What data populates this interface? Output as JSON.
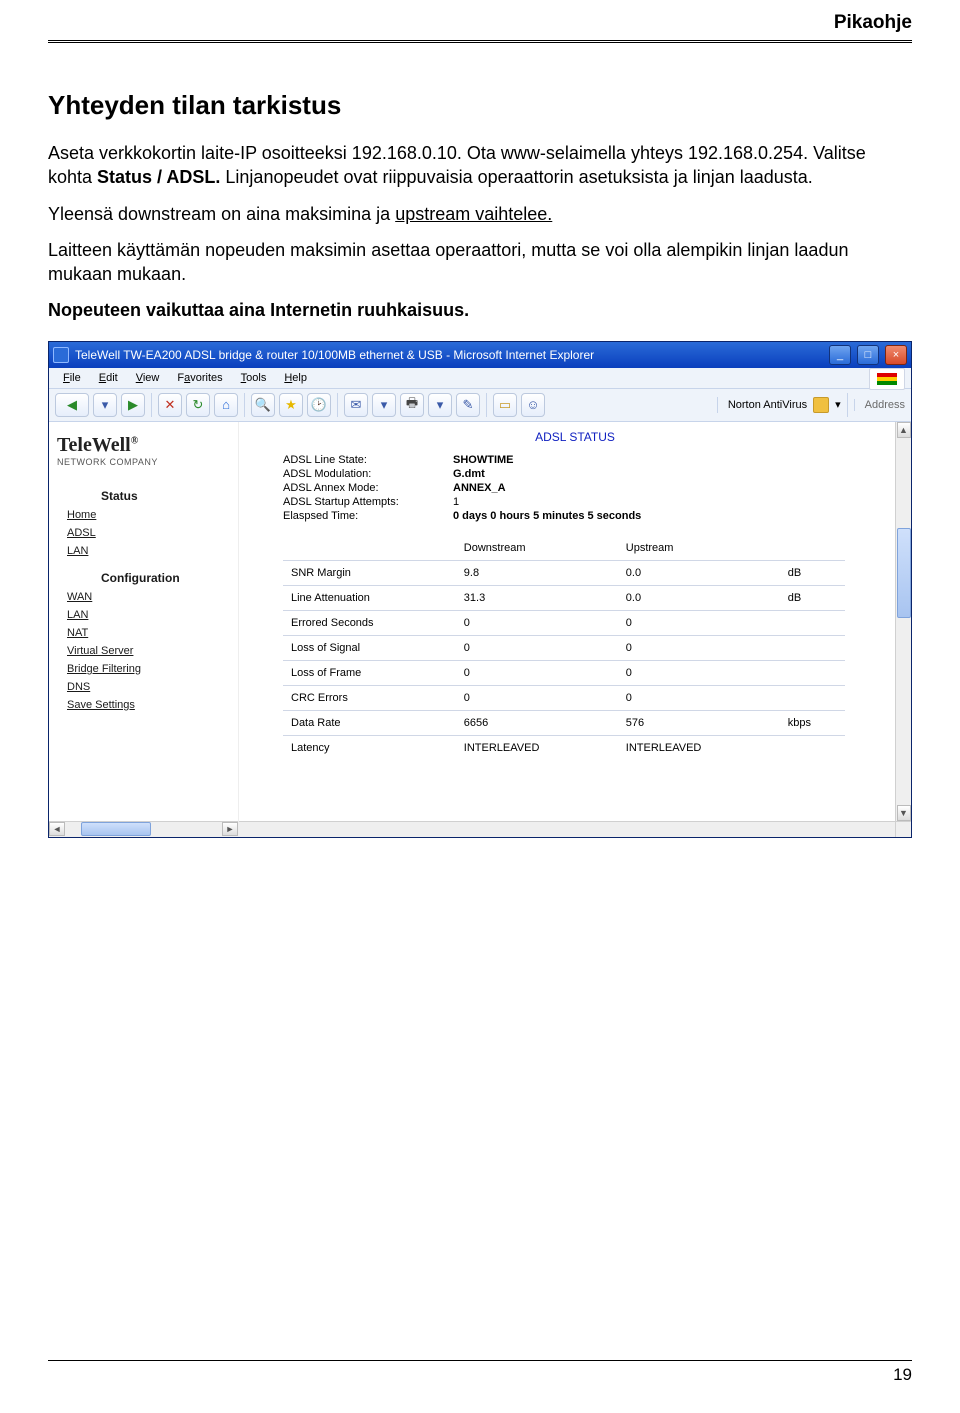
{
  "page": {
    "header_label": "Pikaohje",
    "number": "19"
  },
  "doc": {
    "h1": "Yhteyden tilan tarkistus",
    "p1a": "Aseta verkkokortin laite-IP osoitteeksi 192.168.0.10. Ota www-selaimella yhteys 192.168.0.254. Valitse kohta ",
    "p1b": "Status / ADSL.",
    "p1c": " Linjanopeudet ovat riippuvaisia operaattorin asetuksista ja linjan laadusta.",
    "p2a": "Yleensä downstream on aina maksimina ja ",
    "p2b": "upstream vaihtelee.",
    "p3": "Laitteen käyttämän nopeuden maksimin asettaa operaattori, mutta se voi olla alempikin linjan laadun mukaan mukaan.",
    "p4": "Nopeuteen vaikuttaa aina Internetin ruuhkaisuus."
  },
  "browser": {
    "title": "TeleWell TW-EA200 ADSL bridge & router 10/100MB ethernet & USB - Microsoft Internet Explorer",
    "menu": {
      "file": "File",
      "edit": "Edit",
      "view": "View",
      "favorites": "Favorites",
      "tools": "Tools",
      "help": "Help"
    },
    "norton": "Norton AntiVirus",
    "address_label": "Address",
    "win_btn": {
      "min": "_",
      "max": "□",
      "close": "×"
    },
    "menu_accel": {
      "file": "F",
      "edit": "E",
      "view": "V",
      "favorites": "a",
      "tools": "T",
      "help": "H"
    }
  },
  "sidebar": {
    "brand": "TeleWell",
    "sub": "NETWORK  COMPANY",
    "sec_status": "Status",
    "sec_config": "Configuration",
    "links_status": [
      "Home",
      "ADSL",
      "LAN"
    ],
    "links_config": [
      "WAN",
      "LAN",
      "NAT",
      "Virtual Server",
      "Bridge Filtering",
      "DNS",
      "Save Settings"
    ]
  },
  "status": {
    "title": "ADSL STATUS",
    "rows": [
      {
        "k": "ADSL Line State:",
        "v": "SHOWTIME",
        "bold": true
      },
      {
        "k": "ADSL Modulation:",
        "v": "G.dmt",
        "bold": true
      },
      {
        "k": "ADSL Annex Mode:",
        "v": "ANNEX_A",
        "bold": true
      },
      {
        "k": "ADSL Startup Attempts:",
        "v": "1",
        "bold": false
      },
      {
        "k": "Elaspsed Time:",
        "v": "0 days 0 hours 5 minutes 5 seconds",
        "bold": true
      }
    ],
    "col_down": "Downstream",
    "col_up": "Upstream",
    "table": [
      {
        "label": "SNR Margin",
        "down": "9.8",
        "up": "0.0",
        "unit": "dB"
      },
      {
        "label": "Line Attenuation",
        "down": "31.3",
        "up": "0.0",
        "unit": "dB"
      },
      {
        "label": "Errored Seconds",
        "down": "0",
        "up": "0",
        "unit": ""
      },
      {
        "label": "Loss of Signal",
        "down": "0",
        "up": "0",
        "unit": ""
      },
      {
        "label": "Loss of Frame",
        "down": "0",
        "up": "0",
        "unit": ""
      },
      {
        "label": "CRC Errors",
        "down": "0",
        "up": "0",
        "unit": ""
      },
      {
        "label": "Data Rate",
        "down": "6656",
        "up": "576",
        "unit": "kbps"
      },
      {
        "label": "Latency",
        "down": "INTERLEAVED",
        "up": "INTERLEAVED",
        "unit": ""
      }
    ]
  },
  "icons": {
    "back": "◀",
    "fwd": "▶",
    "stop": "✕",
    "refresh": "↻",
    "home": "⌂",
    "search": "🔍",
    "fav": "★",
    "history": "🕑",
    "mail": "✉",
    "print": "🖶",
    "edit": "✎",
    "chat": "☺",
    "folder": "▭",
    "dd": "▾",
    "left": "◄",
    "right": "►",
    "up": "▲",
    "down": "▼"
  }
}
